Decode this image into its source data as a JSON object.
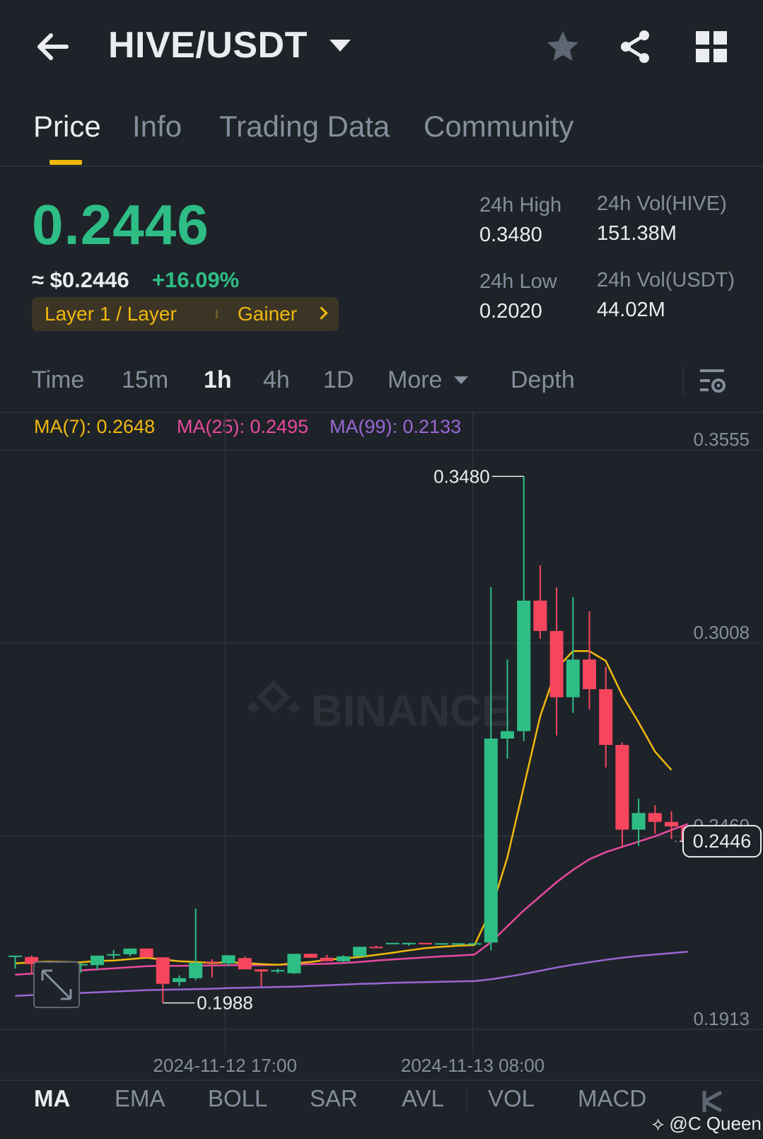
{
  "header": {
    "pair": "HIVE/USDT",
    "icons": [
      "back-arrow-icon",
      "dropdown-caret-icon",
      "star-icon",
      "share-icon",
      "grid-icon"
    ]
  },
  "tabs": [
    {
      "label": "Price",
      "active": true
    },
    {
      "label": "Info",
      "active": false
    },
    {
      "label": "Trading Data",
      "active": false
    },
    {
      "label": "Community",
      "active": false
    }
  ],
  "price": {
    "last": "0.2446",
    "usd": "≈ $0.2446",
    "change": "+16.09%",
    "tag_category": "Layer 1 / Layer",
    "tag_rank": "Gainer"
  },
  "stats": {
    "high_label": "24h High",
    "high": "0.3480",
    "low_label": "24h Low",
    "low": "0.2020",
    "vol_base_label": "24h Vol(HIVE)",
    "vol_base": "151.38M",
    "vol_quote_label": "24h Vol(USDT)",
    "vol_quote": "44.02M"
  },
  "timeframes": {
    "items": [
      "Time",
      "15m",
      "1h",
      "4h",
      "1D"
    ],
    "active": "1h",
    "more": "More",
    "depth": "Depth"
  },
  "ma_legend": {
    "ma7": "MA(7): 0.2648",
    "ma25": "MA(25): 0.2495",
    "ma99": "MA(99): 0.2133"
  },
  "colors": {
    "up": "#2ebd85",
    "down": "#f6465d",
    "ma7": "#f0b90b",
    "ma25": "#e84aa0",
    "ma99": "#9a67d3",
    "accent": "#f0b90b"
  },
  "chart_data": {
    "type": "candlestick",
    "ylim": [
      0.1913,
      0.3555
    ],
    "y_ticks": [
      "0.3555",
      "0.3008",
      "0.2460",
      "0.1913"
    ],
    "x_ticks": [
      "2024-11-12 17:00",
      "2024-11-13 08:00"
    ],
    "high_label": "0.3480",
    "low_label": "0.1988",
    "last_price_label": "0.2446",
    "watermark": "BINANCE",
    "candles": [
      {
        "o": 0.2119,
        "h": 0.2122,
        "l": 0.2085,
        "c": 0.2122
      },
      {
        "o": 0.2118,
        "h": 0.2122,
        "l": 0.2072,
        "c": 0.2098
      },
      {
        "o": 0.2098,
        "h": 0.2105,
        "l": 0.2085,
        "c": 0.21
      },
      {
        "o": 0.2098,
        "h": 0.2105,
        "l": 0.2085,
        "c": 0.2091
      },
      {
        "o": 0.2095,
        "h": 0.21,
        "l": 0.2073,
        "c": 0.2098
      },
      {
        "o": 0.2095,
        "h": 0.2106,
        "l": 0.2082,
        "c": 0.2122
      },
      {
        "o": 0.2126,
        "h": 0.2138,
        "l": 0.2113,
        "c": 0.2126
      },
      {
        "o": 0.2126,
        "h": 0.2142,
        "l": 0.212,
        "c": 0.2142
      },
      {
        "o": 0.2142,
        "h": 0.2142,
        "l": 0.2126,
        "c": 0.2117
      },
      {
        "o": 0.2117,
        "h": 0.2118,
        "l": 0.1988,
        "c": 0.2042
      },
      {
        "o": 0.2047,
        "h": 0.2066,
        "l": 0.2036,
        "c": 0.2058
      },
      {
        "o": 0.2058,
        "h": 0.2255,
        "l": 0.2052,
        "c": 0.2102
      },
      {
        "o": 0.2105,
        "h": 0.2112,
        "l": 0.206,
        "c": 0.2104
      },
      {
        "o": 0.21,
        "h": 0.2123,
        "l": 0.2092,
        "c": 0.2123
      },
      {
        "o": 0.2115,
        "h": 0.212,
        "l": 0.2085,
        "c": 0.2083
      },
      {
        "o": 0.2083,
        "h": 0.2083,
        "l": 0.2035,
        "c": 0.2077
      },
      {
        "o": 0.2077,
        "h": 0.2085,
        "l": 0.2072,
        "c": 0.2081
      },
      {
        "o": 0.2072,
        "h": 0.2127,
        "l": 0.207,
        "c": 0.2127
      },
      {
        "o": 0.2127,
        "h": 0.2127,
        "l": 0.2115,
        "c": 0.2116
      },
      {
        "o": 0.2116,
        "h": 0.2124,
        "l": 0.2106,
        "c": 0.2106
      },
      {
        "o": 0.2106,
        "h": 0.2123,
        "l": 0.2103,
        "c": 0.212
      },
      {
        "o": 0.212,
        "h": 0.2147,
        "l": 0.212,
        "c": 0.2147
      },
      {
        "o": 0.2147,
        "h": 0.215,
        "l": 0.2143,
        "c": 0.2144
      },
      {
        "o": 0.2158,
        "h": 0.2158,
        "l": 0.2158,
        "c": 0.2158
      },
      {
        "o": 0.2155,
        "h": 0.2158,
        "l": 0.215,
        "c": 0.2158
      },
      {
        "o": 0.2158,
        "h": 0.2158,
        "l": 0.2157,
        "c": 0.2156
      },
      {
        "o": 0.2156,
        "h": 0.2157,
        "l": 0.2156,
        "c": 0.2157
      },
      {
        "o": 0.2157,
        "h": 0.2157,
        "l": 0.2157,
        "c": 0.2157
      },
      {
        "o": 0.2157,
        "h": 0.2157,
        "l": 0.2157,
        "c": 0.2157
      },
      {
        "o": 0.2159,
        "h": 0.3166,
        "l": 0.2137,
        "c": 0.2737
      },
      {
        "o": 0.2737,
        "h": 0.2961,
        "l": 0.268,
        "c": 0.2758
      },
      {
        "o": 0.2758,
        "h": 0.348,
        "l": 0.273,
        "c": 0.3128
      },
      {
        "o": 0.3128,
        "h": 0.3228,
        "l": 0.302,
        "c": 0.3042
      },
      {
        "o": 0.3042,
        "h": 0.3165,
        "l": 0.2746,
        "c": 0.2854
      },
      {
        "o": 0.2854,
        "h": 0.3138,
        "l": 0.281,
        "c": 0.2961
      },
      {
        "o": 0.2961,
        "h": 0.3098,
        "l": 0.282,
        "c": 0.2877
      },
      {
        "o": 0.2877,
        "h": 0.2941,
        "l": 0.2655,
        "c": 0.2719
      },
      {
        "o": 0.2719,
        "h": 0.2726,
        "l": 0.243,
        "c": 0.2479
      },
      {
        "o": 0.2479,
        "h": 0.2567,
        "l": 0.2433,
        "c": 0.2526
      },
      {
        "o": 0.2526,
        "h": 0.2548,
        "l": 0.2467,
        "c": 0.2501
      },
      {
        "o": 0.2501,
        "h": 0.2531,
        "l": 0.2452,
        "c": 0.2488
      },
      {
        "o": 0.2488,
        "h": 0.249,
        "l": 0.2446,
        "c": 0.2446
      }
    ],
    "ma7": [
      0.21,
      0.2103,
      0.2105,
      0.2104,
      0.2103,
      0.2107,
      0.2108,
      0.2112,
      0.2116,
      0.2111,
      0.2106,
      0.2104,
      0.2101,
      0.2103,
      0.2101,
      0.2098,
      0.2096,
      0.21,
      0.2104,
      0.211,
      0.2114,
      0.2118,
      0.2124,
      0.213,
      0.2137,
      0.2143,
      0.2147,
      0.215,
      0.2152,
      0.225,
      0.24,
      0.26,
      0.28,
      0.2935,
      0.2985,
      0.2985,
      0.2957,
      0.286,
      0.2783,
      0.27,
      0.2648
    ],
    "ma25": [
      0.2068,
      0.2071,
      0.2074,
      0.2077,
      0.208,
      0.2083,
      0.2086,
      0.2089,
      0.2092,
      0.2093,
      0.2093,
      0.2094,
      0.2094,
      0.2095,
      0.2095,
      0.2095,
      0.2096,
      0.2097,
      0.2098,
      0.2099,
      0.2101,
      0.2104,
      0.2108,
      0.2111,
      0.2114,
      0.2117,
      0.212,
      0.2122,
      0.2125,
      0.216,
      0.2205,
      0.225,
      0.229,
      0.233,
      0.2365,
      0.2395,
      0.2415,
      0.243,
      0.2445,
      0.246,
      0.2478,
      0.2495
    ],
    "ma99": [
      0.2008,
      0.201,
      0.2012,
      0.2014,
      0.2016,
      0.2018,
      0.202,
      0.2022,
      0.2024,
      0.2025,
      0.2026,
      0.2027,
      0.2028,
      0.203,
      0.2031,
      0.2032,
      0.2033,
      0.2034,
      0.2036,
      0.2038,
      0.204,
      0.2042,
      0.2043,
      0.2045,
      0.2046,
      0.2047,
      0.2048,
      0.2049,
      0.205,
      0.2055,
      0.2062,
      0.207,
      0.2079,
      0.2088,
      0.2096,
      0.2103,
      0.211,
      0.2116,
      0.2121,
      0.2125,
      0.2129,
      0.2133
    ]
  },
  "indicators": {
    "items": [
      "MA",
      "EMA",
      "BOLL",
      "SAR",
      "AVL",
      "VOL",
      "MACD"
    ],
    "active": "MA"
  },
  "watermark_text": "@C Queen"
}
